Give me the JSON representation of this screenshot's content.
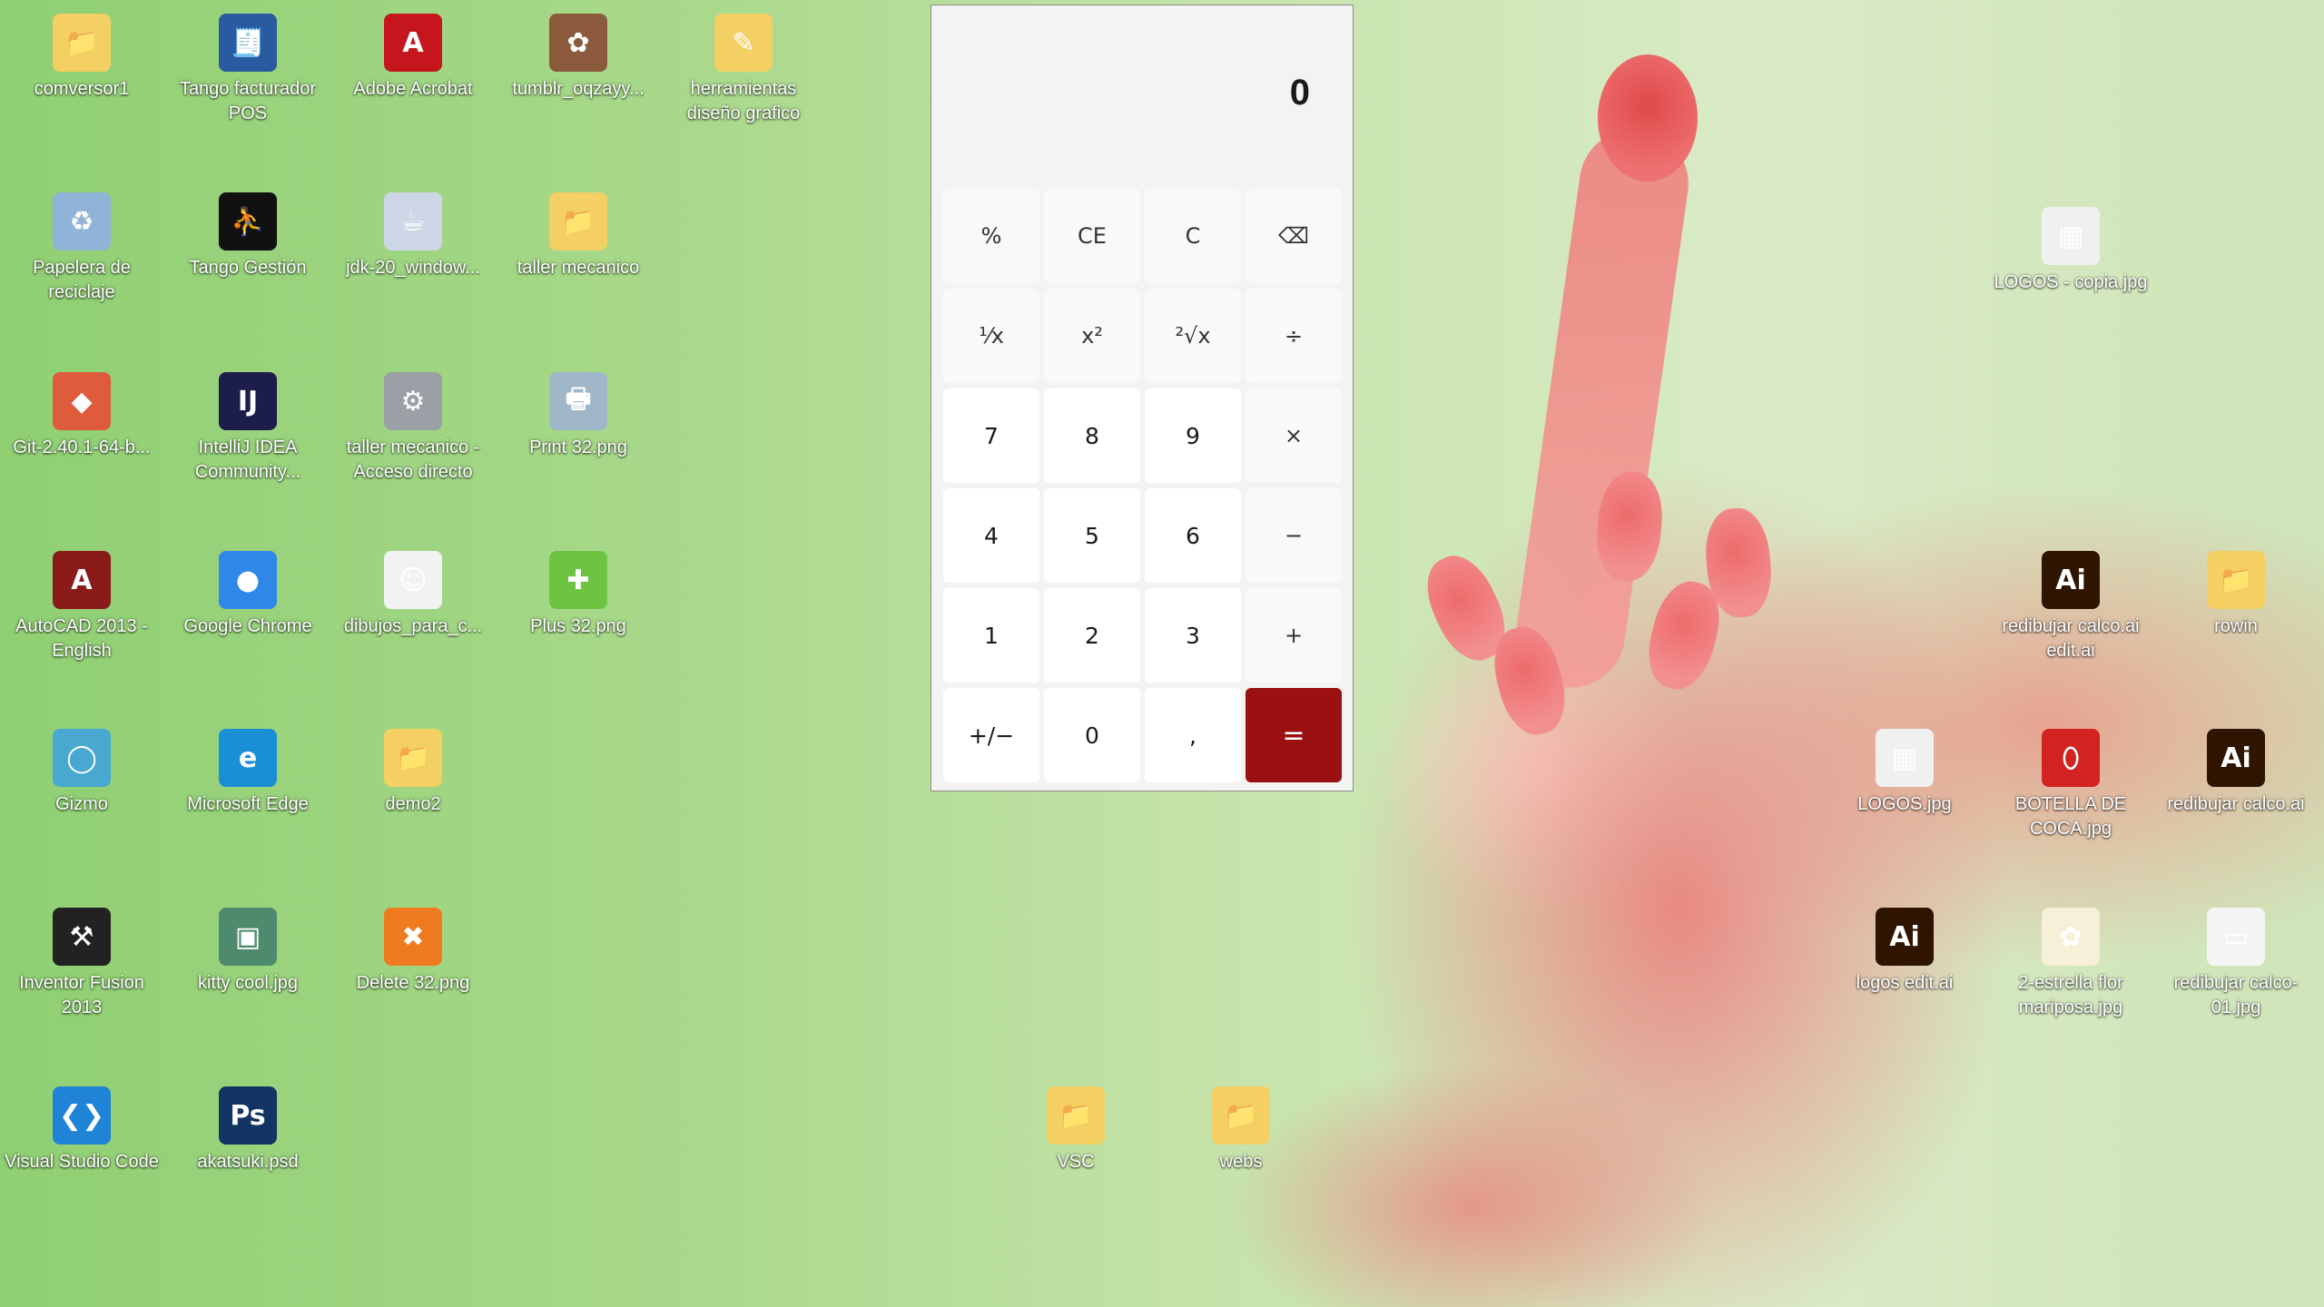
{
  "desktop": {
    "icons": [
      {
        "label": "comversor1",
        "glyph": "📁",
        "color": "#f4cf63"
      },
      {
        "label": "Tango facturador POS",
        "glyph": "🧾",
        "color": "#2a5aa0"
      },
      {
        "label": "Adobe Acrobat",
        "glyph": "A",
        "color": "#c4161c"
      },
      {
        "label": "tumblr_oqzayy...",
        "glyph": "✿",
        "color": "#8b5a3c"
      },
      {
        "label": "herramientas diseño grafico",
        "glyph": "✎",
        "color": "#f4cf63"
      },
      {
        "label": "Papelera de reciclaje",
        "glyph": "♻",
        "color": "#8fb4d8"
      },
      {
        "label": "Tango Gestión",
        "glyph": "⛹",
        "color": "#111111"
      },
      {
        "label": "jdk-20_window...",
        "glyph": "☕",
        "color": "#cdd6e6"
      },
      {
        "label": "taller mecanico",
        "glyph": "📁",
        "color": "#f4cf63"
      },
      {
        "label": "Git-2.40.1-64-b...",
        "glyph": "◆",
        "color": "#de5b3c"
      },
      {
        "label": "IntelliJ IDEA Community...",
        "glyph": "IJ",
        "color": "#1d1d4b"
      },
      {
        "label": "taller mecanico - Acceso directo",
        "glyph": "⚙",
        "color": "#9aa0a6"
      },
      {
        "label": "Print 32.png",
        "glyph": "🖶",
        "color": "#9fb7c9"
      },
      {
        "label": "AutoCAD 2013 - English",
        "glyph": "A",
        "color": "#8b1a1a"
      },
      {
        "label": "Google Chrome",
        "glyph": "●",
        "color": "#2f88e8"
      },
      {
        "label": "dibujos_para_c...",
        "glyph": "☺",
        "color": "#f2f2f2"
      },
      {
        "label": "Plus 32.png",
        "glyph": "✚",
        "color": "#6cc440"
      },
      {
        "label": "Gizmo",
        "glyph": "◯",
        "color": "#48a8d0"
      },
      {
        "label": "Microsoft Edge",
        "glyph": "e",
        "color": "#1b8fd6"
      },
      {
        "label": "demo2",
        "glyph": "📁",
        "color": "#f4cf63"
      },
      {
        "label": "Inventor Fusion 2013",
        "glyph": "⚒",
        "color": "#222222"
      },
      {
        "label": "kitty cool.jpg",
        "glyph": "▣",
        "color": "#4e8a6d"
      },
      {
        "label": "Delete 32.png",
        "glyph": "✖",
        "color": "#f07a1f"
      },
      {
        "label": "Visual Studio Code",
        "glyph": "❮❯",
        "color": "#1f83d6"
      },
      {
        "label": "akatsuki.psd",
        "glyph": "Ps",
        "color": "#123564"
      },
      {
        "label": "VSC",
        "glyph": "📁",
        "color": "#f4cf63"
      },
      {
        "label": "webs",
        "glyph": "📁",
        "color": "#f4cf63"
      },
      {
        "label": "LOGOS - copia.jpg",
        "glyph": "▦",
        "color": "#f0f0f0"
      },
      {
        "label": "redibujar calco.ai edit.ai",
        "glyph": "Ai",
        "color": "#2f1500"
      },
      {
        "label": "rowin",
        "glyph": "📁",
        "color": "#f4cf63"
      },
      {
        "label": "LOGOS.jpg",
        "glyph": "▦",
        "color": "#f0f0f0"
      },
      {
        "label": "BOTELLA DE COCA.jpg",
        "glyph": "⬯",
        "color": "#d22222"
      },
      {
        "label": "redibujar calco.ai",
        "glyph": "Ai",
        "color": "#2f1500"
      },
      {
        "label": "logos edit.ai",
        "glyph": "Ai",
        "color": "#2f1500"
      },
      {
        "label": "2-estrella flor mariposa.jpg",
        "glyph": "✿",
        "color": "#f6f0d8"
      },
      {
        "label": "redibujar calco-01.jpg",
        "glyph": "▭",
        "color": "#f4f4f4"
      }
    ]
  },
  "calculator": {
    "display": "0",
    "keys": [
      "%",
      "CE",
      "C",
      "⌫",
      "¹⁄x",
      "x²",
      "²√x",
      "÷",
      "7",
      "8",
      "9",
      "×",
      "4",
      "5",
      "6",
      "−",
      "1",
      "2",
      "3",
      "+",
      "+/−",
      "0",
      ",",
      "="
    ]
  }
}
